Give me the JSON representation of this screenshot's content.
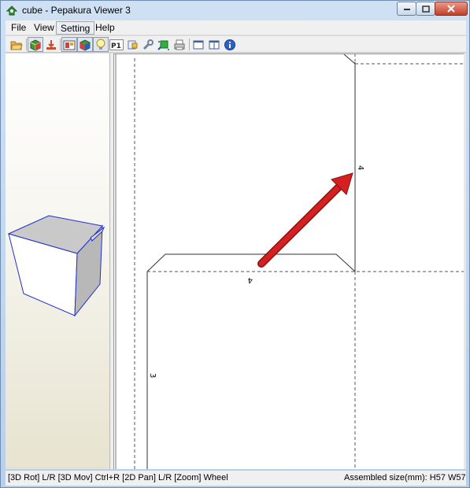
{
  "window": {
    "title": "cube - Pepakura Viewer 3",
    "icon": "pepakura-app-icon"
  },
  "menu": {
    "items": [
      {
        "label": "File"
      },
      {
        "label": "View"
      },
      {
        "label": "Setting",
        "active": true
      },
      {
        "label": "Help"
      }
    ]
  },
  "toolbar": {
    "icons": [
      "open-folder-icon",
      "3d-view-icon",
      "unfold-icon",
      "2d-view-icon",
      "3d-2d-split-icon",
      "lightbulb-icon",
      "page-number-icon",
      "texture-icon",
      "settings-wrench-icon",
      "green-flap-icon",
      "print-icon",
      "layout-single-icon",
      "layout-dual-icon",
      "info-icon"
    ],
    "page_number_label": "P1"
  },
  "canvas": {
    "edge_labels": [
      "4",
      "4",
      "3"
    ],
    "arrow_color": "#d42020"
  },
  "status": {
    "left_text": "[3D Rot] L/R [3D Mov] Ctrl+R [2D Pan] L/R [Zoom] Wheel",
    "right_text": "Assembled size(mm): H57 W57"
  },
  "colors": {
    "cube_edge": "#2030d0",
    "cube_top": "#c9c9c9",
    "cube_side": "#b5b5b5"
  }
}
